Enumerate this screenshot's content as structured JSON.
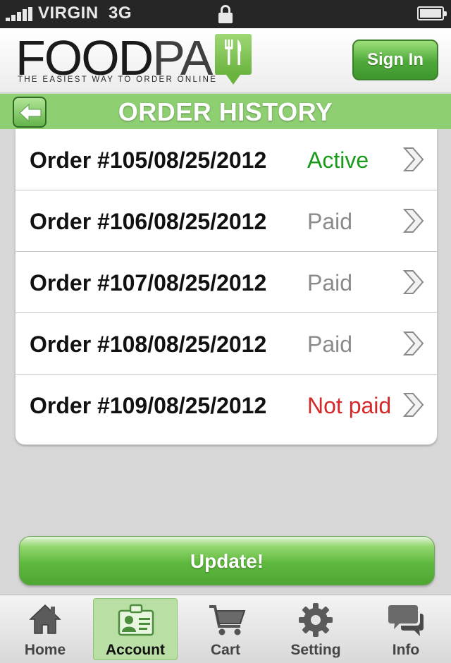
{
  "status_bar": {
    "carrier": "VIRGIN",
    "network": "3G",
    "icons": [
      "signal-icon",
      "lock-icon",
      "battery-icon"
    ]
  },
  "header": {
    "logo_text_a": "FOOD",
    "logo_text_b": "PAL",
    "logo_tagline": "THE EASIEST WAY TO ORDER ONLINE",
    "logo_icon": "fork-knife-icon",
    "sign_in_label": "Sign In"
  },
  "title_bar": {
    "back_icon": "back-arrow-icon",
    "title": "ORDER HISTORY"
  },
  "orders": [
    {
      "label": "Order #105/08/25/2012",
      "status": "Active",
      "status_color": "#1a9a1a"
    },
    {
      "label": "Order #106/08/25/2012",
      "status": "Paid",
      "status_color": "#8a8a8a"
    },
    {
      "label": "Order #107/08/25/2012",
      "status": "Paid",
      "status_color": "#8a8a8a"
    },
    {
      "label": "Order #108/08/25/2012",
      "status": "Paid",
      "status_color": "#8a8a8a"
    },
    {
      "label": "Order #109/08/25/2012",
      "status": "Not paid",
      "status_color": "#d62828"
    }
  ],
  "update_label": "Update!",
  "tabs": [
    {
      "label": "Home",
      "icon": "home-icon",
      "active": false
    },
    {
      "label": "Account",
      "icon": "account-card-icon",
      "active": true
    },
    {
      "label": "Cart",
      "icon": "cart-icon",
      "active": false
    },
    {
      "label": "Setting",
      "icon": "gear-icon",
      "active": false
    },
    {
      "label": "Info",
      "icon": "chat-bubbles-icon",
      "active": false
    }
  ],
  "colors": {
    "accent_green": "#8ecf72",
    "status_bar_bg": "#262626"
  }
}
